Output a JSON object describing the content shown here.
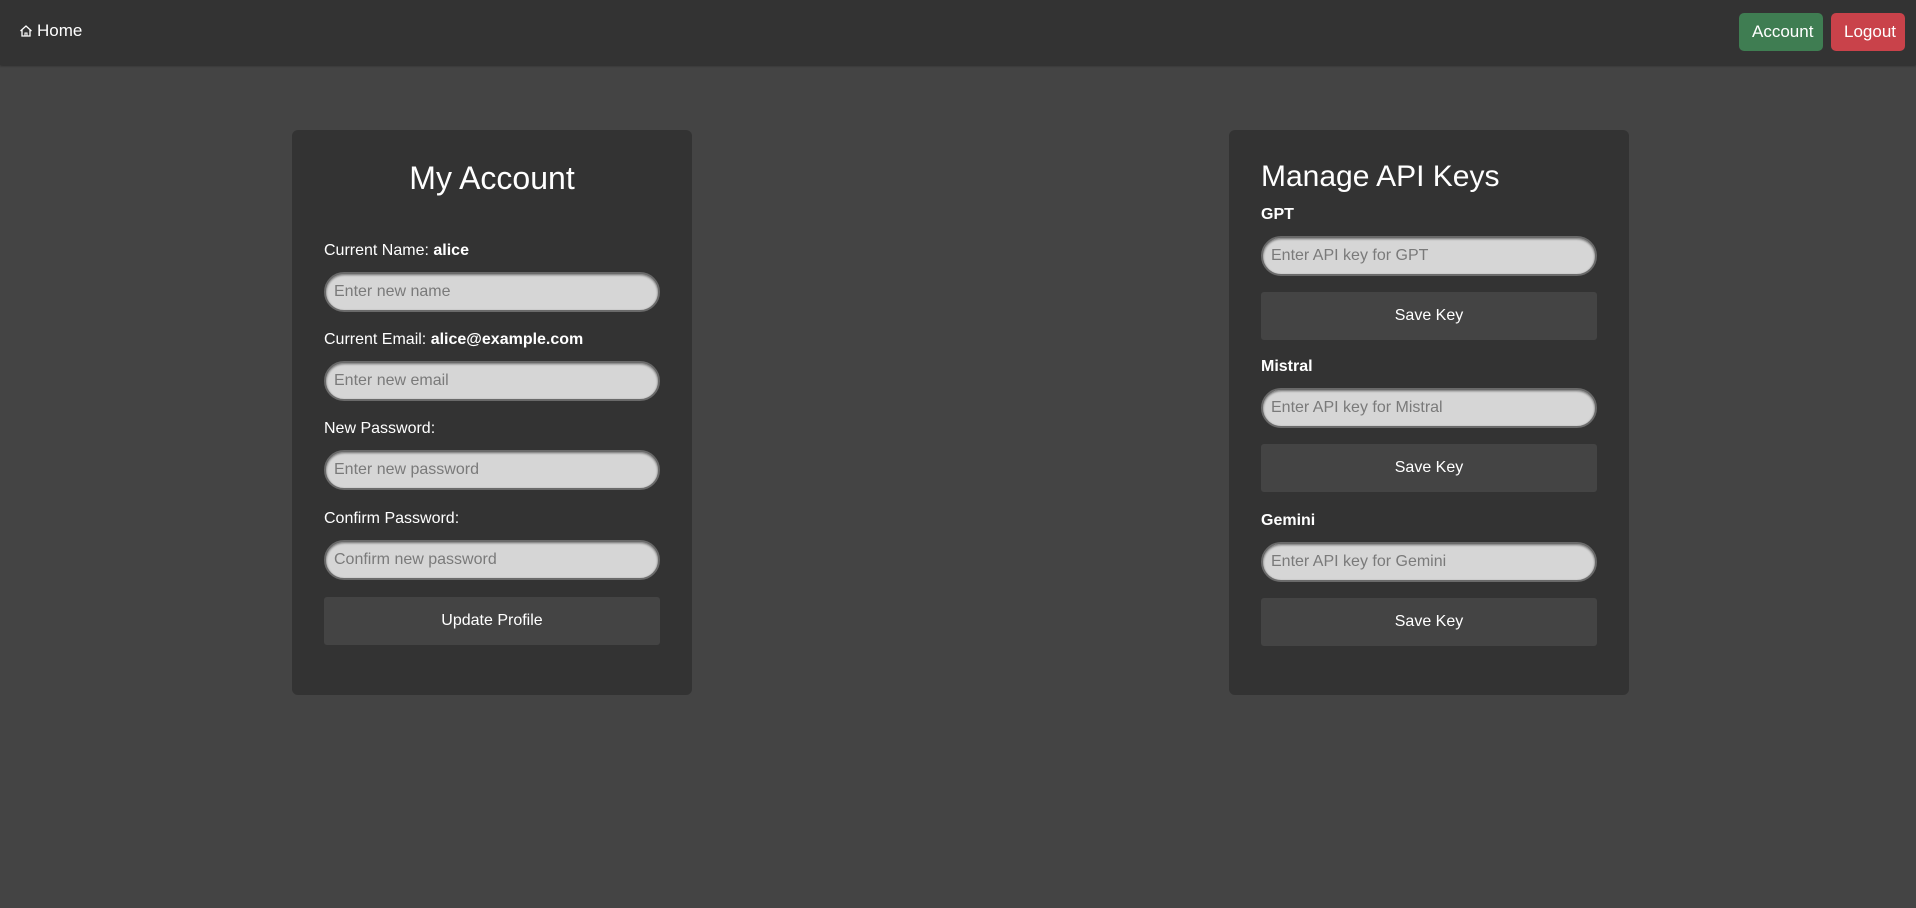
{
  "nav": {
    "home_label": "Home",
    "account_label": "Account",
    "logout_label": "Logout",
    "colors": {
      "account": "#3f7d52",
      "logout": "#c9424a"
    }
  },
  "account": {
    "title": "My Account",
    "current_name_label": "Current Name:",
    "current_name_value": "alice",
    "name_placeholder": "Enter new name",
    "current_email_label": "Current Email:",
    "current_email_value": "alice@example.com",
    "email_placeholder": "Enter new email",
    "new_password_label": "New Password:",
    "new_password_placeholder": "Enter new password",
    "confirm_password_label": "Confirm Password:",
    "confirm_password_placeholder": "Confirm new password",
    "update_button": "Update Profile"
  },
  "api_keys": {
    "title": "Manage API Keys",
    "providers": [
      {
        "name": "GPT",
        "placeholder": "Enter API key for GPT",
        "save_label": "Save Key"
      },
      {
        "name": "Mistral",
        "placeholder": "Enter API key for Mistral",
        "save_label": "Save Key"
      },
      {
        "name": "Gemini",
        "placeholder": "Enter API key for Gemini",
        "save_label": "Save Key"
      }
    ]
  }
}
